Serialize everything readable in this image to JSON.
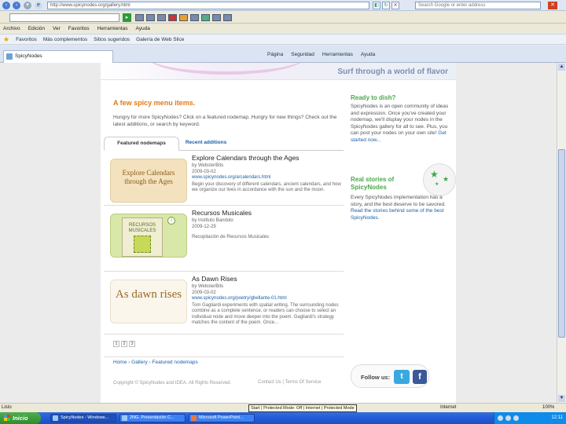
{
  "browser": {
    "address_url": "http://www.spicynodes.org/gallery.html",
    "search_placeholder": "Search Google or enter address",
    "menu": [
      "Archivo",
      "Edición",
      "Ver",
      "Favoritos",
      "Herramientas",
      "Ayuda"
    ],
    "favorites_label": "Favoritos",
    "favorites_items": [
      "Más complementos",
      "Sitios sugeridos",
      "Galería de Web Slice"
    ],
    "tab_title": "SpicyNodes",
    "command_bar": [
      "Página",
      "Seguridad",
      "Herramientas",
      "Ayuda"
    ]
  },
  "page": {
    "banner_text": "Surf through a world of flavor",
    "heading": "A few spicy menu items.",
    "intro": "Hungry for more SpicyNodes? Click on a featured nodemap. Hungry for new things? Check out the latest additions, or search by keyword.",
    "tabs": {
      "featured": "Featured nodemaps",
      "recent": "Recent additions"
    },
    "items": [
      {
        "thumb_text": "Explore Calendars through the Ages",
        "title": "Explore Calendars through the Ages",
        "by": "by WebsterBits",
        "date": "2009-03-02",
        "link": "www.spicynodes.org/a/calendars.html",
        "desc": "Begin your discovery of different calendars, ancient calendars, and how we organize our lives in accordance with the sun and the moon."
      },
      {
        "thumb_text": "RECURSOS MUSICALES",
        "title": "Recursos Musicales",
        "by": "by Instituto Bandolo",
        "date": "2009-12-29",
        "link": "",
        "desc": "Recopilación de Recursos Musicales"
      },
      {
        "thumb_text": "As dawn rises",
        "title": "As Dawn Rises",
        "by": "by WebsterBits",
        "date": "2009-03-02",
        "link": "www.spicynodes.org/poetry/gbellante-01.html",
        "desc": "Tom Gagliardi experiments with spatial writing. The surrounding nodes combine as a complete sentence, or readers can choose to select an individual node and move deeper into the poem. Gagliardi's strategy matches the content of the poem. Once..."
      }
    ],
    "pager": [
      "1",
      "2",
      "3"
    ],
    "sidebar": {
      "ready_heading": "Ready to dish?",
      "ready_text": "SpicyNodes is an open community of ideas and expression. Once you've created your nodemap, we'll display your nodes in the SpicyNodes gallery for all to see. Plus, you can post your nodes on your own site!",
      "ready_link": "Get started now...",
      "real_heading": "Real stories of SpicyNodes",
      "real_text": "Every SpicyNodes implementation has a story, and the best deserve to be savored.",
      "real_link": "Read the stories behind some of the best SpicyNodes."
    },
    "breadcrumb": [
      "Home",
      "Gallery",
      "Featured nodemaps"
    ],
    "copyright": "Copyright © SpicyNodes and IDEA. All Rights Reserved.",
    "footer_links": "Contact Us | Terms Of Service",
    "follow_label": "Follow us:"
  },
  "status": {
    "left": "Listo",
    "tooltip": "Start | Protected Mode: Off | Internet | Protected Mode",
    "zone": "Internet",
    "zoom": "100%"
  },
  "taskbar": {
    "start": "Inicio",
    "tasks": [
      "SpicyNodes - Windows...",
      "2NG. Presentación C...",
      "Microsoft PowerPoint..."
    ],
    "clock": "12:11"
  }
}
